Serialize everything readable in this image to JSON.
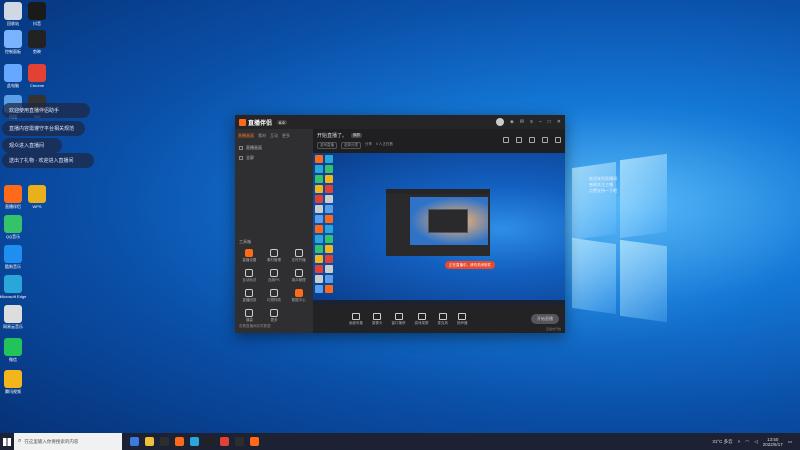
{
  "desktop": {
    "icons_left": [
      {
        "label": "回收站",
        "color": "#cfd8e3"
      },
      {
        "label": "控制面板",
        "color": "#7ab4ff"
      },
      {
        "label": "此电脑",
        "color": "#66a8ff"
      },
      {
        "label": "网络",
        "color": "#5a9fe8"
      },
      {
        "label": "直播伴侣",
        "color": "#ff6a1a"
      },
      {
        "label": "QQ音乐",
        "color": "#35c26b"
      },
      {
        "label": "酷狗音乐",
        "color": "#1e8ef0"
      },
      {
        "label": "Microsoft Edge",
        "color": "#2aa7d8"
      },
      {
        "label": "网易云音乐",
        "color": "#dddddd"
      },
      {
        "label": "微信",
        "color": "#22c35a"
      },
      {
        "label": "腾讯视频",
        "color": "#f2b51c"
      }
    ],
    "icons_right_col": [
      {
        "label": "抖音",
        "color": "#1a1a1a"
      },
      {
        "label": "剪映",
        "color": "#222222"
      },
      {
        "label": "Chrome",
        "color": "#e34133"
      },
      {
        "label": "360",
        "color": "#333"
      },
      {
        "label": "WPS",
        "color": "#e8b01c"
      }
    ],
    "notifications": [
      "欢迎使用直播伴侣助手",
      "直播内容需遵守平台相关规范",
      "观众进入直播间",
      "送出了礼物 · 欢迎进入直播间"
    ],
    "overlay_list": [
      "欢迎来到直播间",
      "感谢关注主播",
      "点赞支持一下吧"
    ]
  },
  "app": {
    "brand": "直播伴侣",
    "version": "6.0",
    "side_tabs": [
      "直播画面",
      "素材",
      "互动",
      "更多"
    ],
    "scenes": [
      "直播画面",
      "全屏"
    ],
    "tools_title": "工具箱",
    "tools": [
      {
        "label": "直播设置",
        "hot": true
      },
      {
        "label": "素材管理",
        "hot": false
      },
      {
        "label": "定时开播",
        "hot": false
      },
      {
        "label": "互动玩法",
        "hot": false
      },
      {
        "label": "连线PK",
        "hot": false
      },
      {
        "label": "观众管理",
        "hot": false
      },
      {
        "label": "直播回放",
        "hot": false
      },
      {
        "label": "礼物特效",
        "hot": false
      },
      {
        "label": "数据中心",
        "hot": true
      },
      {
        "label": "福袋",
        "hot": false
      },
      {
        "label": "更多",
        "hot": false
      }
    ],
    "side_footer": "查看直播间实时数据",
    "main_title": "开始直播了。",
    "main_tag": "横屏",
    "sub_items": [
      "游戏直播",
      "选择分类",
      "分享",
      "0 人正在看"
    ],
    "inner_notification": "正在直播中，请勿关闭软件",
    "controls": [
      "画面采集",
      "摄像头",
      "窗口捕获",
      "游戏录屏",
      "麦克风",
      "扬声器"
    ],
    "go_live": "开始直播",
    "status_line": "直播未开始"
  },
  "taskbar": {
    "search_placeholder": "在这里输入你要搜索的内容",
    "temperature": "31°C 多云",
    "time": "13:50",
    "date": "2022/6/17",
    "pinned": [
      "#3a7be0",
      "#f0c03a",
      "#2d2d2d",
      "#ff6a1a",
      "#2aa7d8",
      "#222",
      "#e34133",
      "#2d2d2d",
      "#ff6a1a"
    ]
  }
}
